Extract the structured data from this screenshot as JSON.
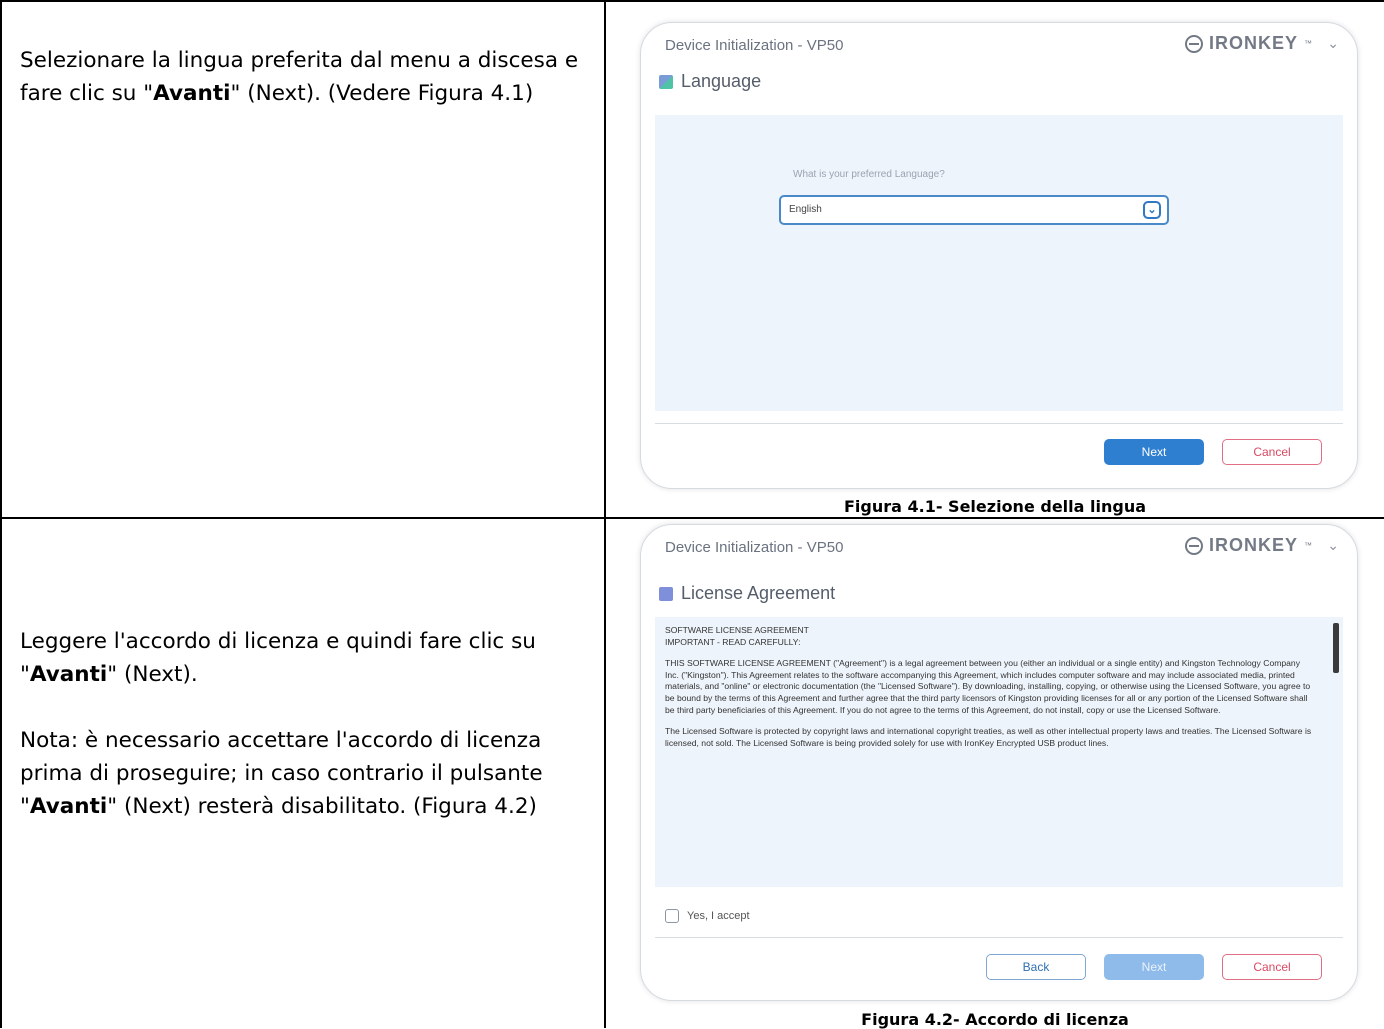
{
  "rows": [
    {
      "paragraphs": [
        [
          {
            "t": "Selezionare la lingua preferita dal menu a discesa e fare clic su \""
          },
          {
            "t": "Avanti",
            "b": true
          },
          {
            "t": "\" (Next). (Vedere Figura 4.1)"
          }
        ]
      ],
      "caption": "Figura 4.1- Selezione della lingua"
    },
    {
      "paragraphs": [
        [
          {
            "t": "Leggere l'accordo di licenza e quindi fare clic su \""
          },
          {
            "t": "Avanti",
            "b": true
          },
          {
            "t": "\" (Next)."
          }
        ],
        [
          {
            "t": "Nota: è necessario accettare l'accordo di licenza prima di proseguire; in caso contrario il pulsante \""
          },
          {
            "t": "Avanti",
            "b": true
          },
          {
            "t": "\" (Next) resterà disabilitato. (Figura 4.2)"
          }
        ]
      ],
      "caption": "Figura 4.2- Accordo di licenza"
    }
  ],
  "dialog1": {
    "title": "Device Initialization - VP50",
    "brand": "IRONKEY",
    "brand_tm": "™",
    "section_title": "Language",
    "question": "What is your preferred Language?",
    "selected_language": "English",
    "next_label": "Next",
    "cancel_label": "Cancel"
  },
  "dialog2": {
    "title": "Device Initialization - VP50",
    "brand": "IRONKEY",
    "brand_tm": "™",
    "section_title": "License Agreement",
    "license_heading_1": "SOFTWARE LICENSE AGREEMENT",
    "license_heading_2": "IMPORTANT - READ CAREFULLY:",
    "license_para_1": "THIS SOFTWARE LICENSE AGREEMENT (\"Agreement\") is a legal agreement between you (either an individual or a single entity) and Kingston Technology Company Inc. (\"Kingston\"). This Agreement relates to the software accompanying this Agreement, which includes computer software and may include associated media, printed materials, and \"online\" or electronic documentation (the \"Licensed Software\"). By downloading, installing, copying, or otherwise using the Licensed Software, you agree to be bound by the terms of this Agreement and further agree that the third party licensors of Kingston providing licenses for all or any portion of the Licensed Software shall be third party beneficiaries of this Agreement. If you do not agree to the terms of this Agreement, do not install, copy or use the Licensed Software.",
    "license_para_2": "The Licensed Software is protected by copyright laws and international copyright treaties, as well as other intellectual property laws and treaties. The Licensed Software is licensed, not sold. The Licensed Software is being provided solely for use with IronKey Encrypted USB product lines.",
    "accept_label": "Yes, I accept",
    "back_label": "Back",
    "next_label": "Next",
    "cancel_label": "Cancel"
  }
}
